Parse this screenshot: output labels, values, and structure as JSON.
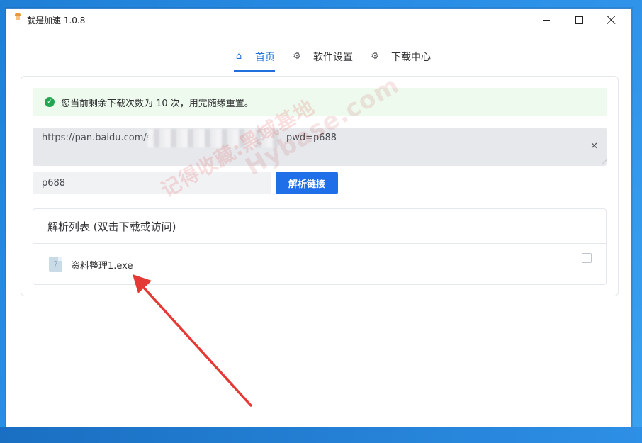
{
  "window": {
    "title": "就是加速  1.0.8"
  },
  "tabs": [
    {
      "label": "首页",
      "icon": "home-icon",
      "active": true
    },
    {
      "label": "软件设置",
      "icon": "gear-icon",
      "active": false
    },
    {
      "label": "下载中心",
      "icon": "gear-icon",
      "active": false
    }
  ],
  "alert": {
    "text": "您当前剩余下载次数为 10 次，用完随缘重置。",
    "color": "#22a652"
  },
  "link_input": {
    "value_prefix": "https://pan.baidu.com/s/",
    "value_suffix": "pwd=p688"
  },
  "password_input": {
    "value": "p688"
  },
  "parse_button": {
    "label": "解析链接",
    "color": "#1f6fe8"
  },
  "file_list": {
    "title": "解析列表 (双击下载或访问)",
    "items": [
      {
        "name": "资料整理1.exe",
        "icon": "unknown-file-icon"
      }
    ]
  },
  "watermark": {
    "line1": "记得收藏:黑域基地",
    "line2": "Hybase.com"
  },
  "accent_color": "#1f6fdc"
}
